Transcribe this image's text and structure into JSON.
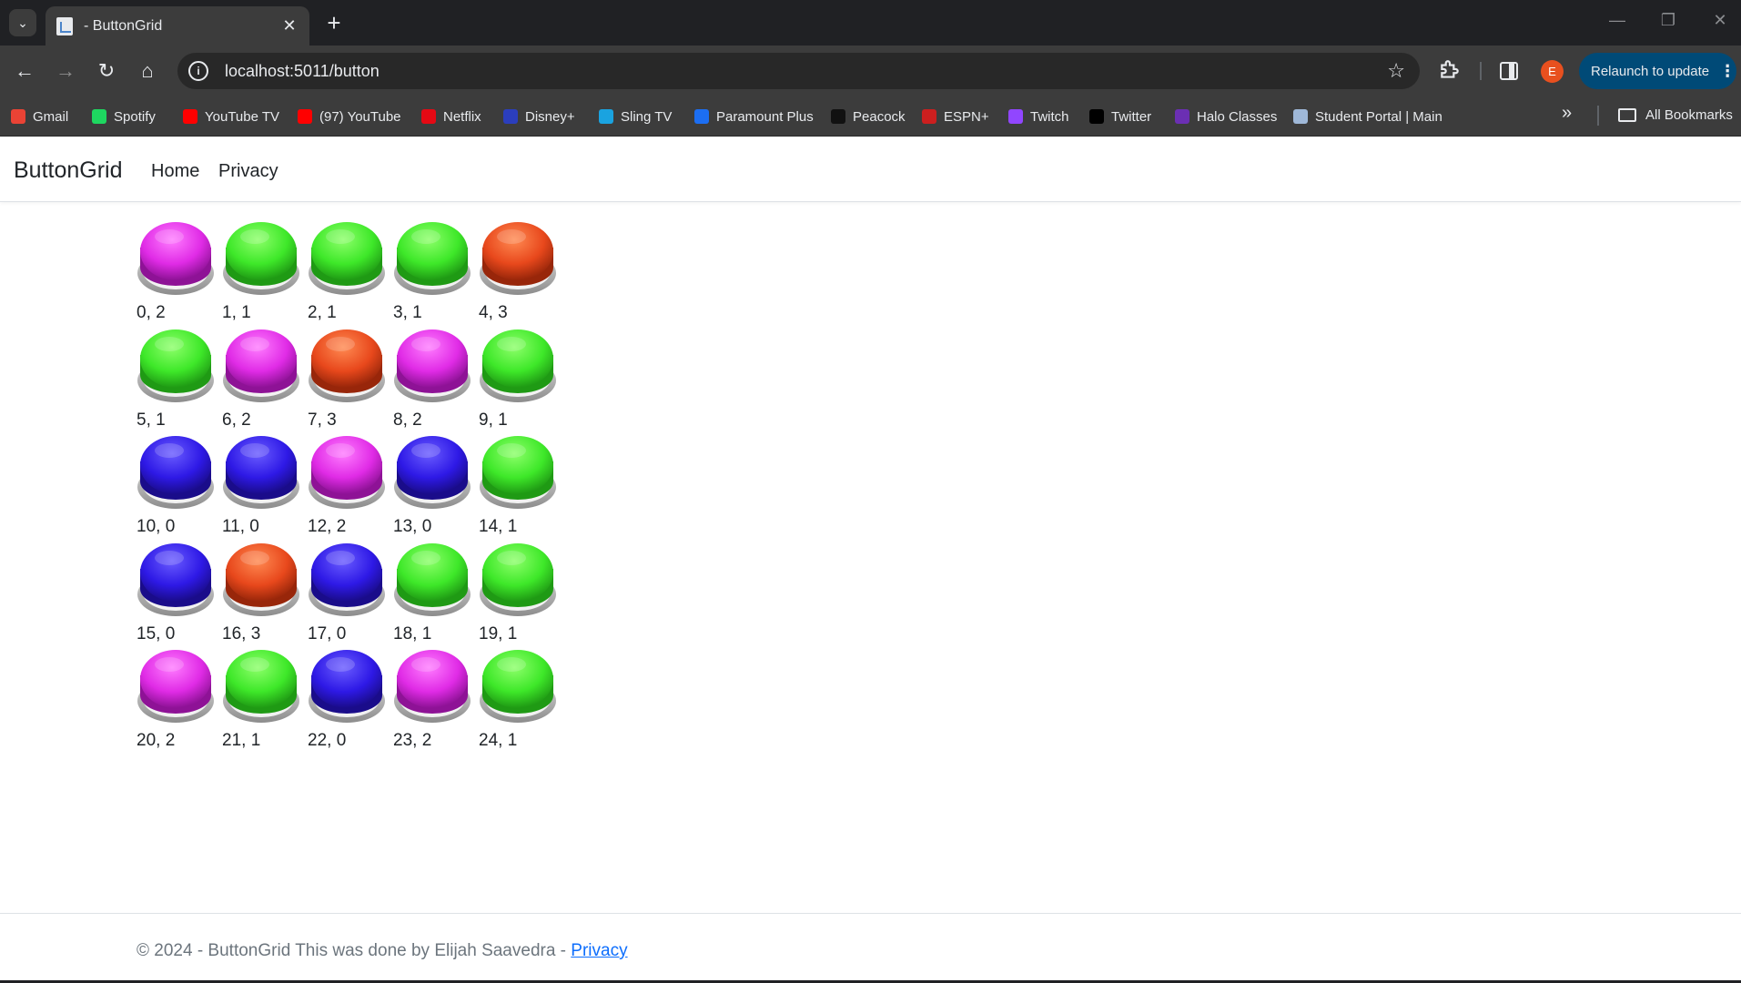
{
  "browser": {
    "tab_title": "- ButtonGrid",
    "url": "localhost:5011/button",
    "avatar_letter": "E",
    "relaunch_label": "Relaunch to update",
    "bookmarks": [
      {
        "label": "Gmail",
        "icon": "gmail-icon",
        "color": "#ea4335"
      },
      {
        "label": "Spotify",
        "icon": "spotify-icon",
        "color": "#1ed760"
      },
      {
        "label": "YouTube TV",
        "icon": "youtube-tv-icon",
        "color": "#ff0000"
      },
      {
        "label": "(97) YouTube",
        "icon": "youtube-icon",
        "color": "#ff0000"
      },
      {
        "label": "Netflix",
        "icon": "netflix-icon",
        "color": "#e50914"
      },
      {
        "label": "Disney+",
        "icon": "disney-plus-icon",
        "color": "#2b3ebd"
      },
      {
        "label": "Sling TV",
        "icon": "sling-tv-icon",
        "color": "#1aa3e0"
      },
      {
        "label": "Paramount Plus",
        "icon": "paramount-plus-icon",
        "color": "#1c6ef2"
      },
      {
        "label": "Peacock",
        "icon": "peacock-icon",
        "color": "#111111"
      },
      {
        "label": "ESPN+",
        "icon": "espn-icon",
        "color": "#cc1f1f"
      },
      {
        "label": "Twitch",
        "icon": "twitch-icon",
        "color": "#9146ff"
      },
      {
        "label": "Twitter",
        "icon": "x-twitter-icon",
        "color": "#000000"
      },
      {
        "label": "Halo Classes",
        "icon": "halo-icon",
        "color": "#6b2fb3"
      },
      {
        "label": "Student Portal | Main",
        "icon": "document-icon",
        "color": "#9fb8d8"
      }
    ],
    "all_bookmarks_label": "All Bookmarks"
  },
  "app": {
    "brand": "ButtonGrid",
    "nav": {
      "home": "Home",
      "privacy": "Privacy"
    }
  },
  "state_colors": {
    "0": "blue",
    "1": "green",
    "2": "magenta",
    "3": "orange"
  },
  "buttons": [
    {
      "label": "0, 2",
      "state": 2
    },
    {
      "label": "1, 1",
      "state": 1
    },
    {
      "label": "2, 1",
      "state": 1
    },
    {
      "label": "3, 1",
      "state": 1
    },
    {
      "label": "4, 3",
      "state": 3
    },
    {
      "label": "5, 1",
      "state": 1
    },
    {
      "label": "6, 2",
      "state": 2
    },
    {
      "label": "7, 3",
      "state": 3
    },
    {
      "label": "8, 2",
      "state": 2
    },
    {
      "label": "9, 1",
      "state": 1
    },
    {
      "label": "10, 0",
      "state": 0
    },
    {
      "label": "11, 0",
      "state": 0
    },
    {
      "label": "12, 2",
      "state": 2
    },
    {
      "label": "13, 0",
      "state": 0
    },
    {
      "label": "14, 1",
      "state": 1
    },
    {
      "label": "15, 0",
      "state": 0
    },
    {
      "label": "16, 3",
      "state": 3
    },
    {
      "label": "17, 0",
      "state": 0
    },
    {
      "label": "18, 1",
      "state": 1
    },
    {
      "label": "19, 1",
      "state": 1
    },
    {
      "label": "20, 2",
      "state": 2
    },
    {
      "label": "21, 1",
      "state": 1
    },
    {
      "label": "22, 0",
      "state": 0
    },
    {
      "label": "23, 2",
      "state": 2
    },
    {
      "label": "24, 1",
      "state": 1
    }
  ],
  "footer": {
    "text": "© 2024 - ButtonGrid This was done by Elijah Saavedra - ",
    "privacy_link": "Privacy"
  }
}
